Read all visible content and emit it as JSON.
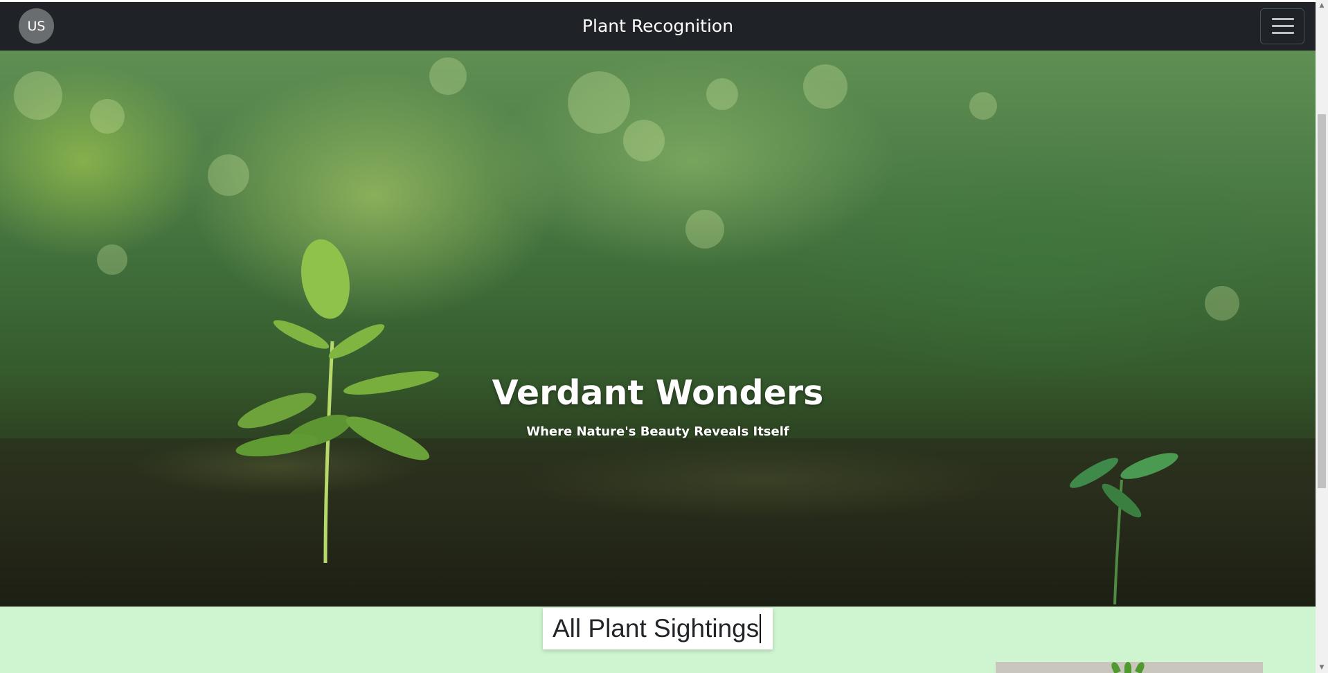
{
  "navbar": {
    "avatar_initials": "US",
    "brand": "Plant Recognition",
    "menu_icon": "hamburger-menu-icon"
  },
  "hero": {
    "title": "Verdant Wonders",
    "subtitle": "Where Nature's Beauty Reveals Itself"
  },
  "sightings": {
    "title": "All Plant Sightings"
  },
  "scrollbar": {
    "up_arrow": "▲",
    "down_arrow": "▼"
  }
}
